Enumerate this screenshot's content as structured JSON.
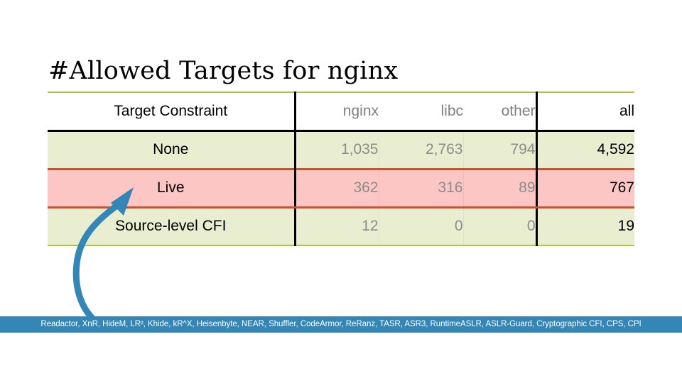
{
  "slide": {
    "title": "#Allowed Targets for nginx"
  },
  "table": {
    "columns": [
      {
        "key": "constraint",
        "label": "Target Constraint"
      },
      {
        "key": "nginx",
        "label": "nginx"
      },
      {
        "key": "libc",
        "label": "libc"
      },
      {
        "key": "other",
        "label": "other"
      },
      {
        "key": "all",
        "label": "all"
      }
    ],
    "rows": [
      {
        "constraint": "None",
        "nginx": "1,035",
        "libc": "2,763",
        "other": "794",
        "all": "4,592",
        "highlight": false
      },
      {
        "constraint": "Live",
        "nginx": "362",
        "libc": "316",
        "other": "89",
        "all": "767",
        "highlight": true
      },
      {
        "constraint": "Source-level CFI",
        "nginx": "12",
        "libc": "0",
        "other": "0",
        "all": "19",
        "highlight": false
      }
    ]
  },
  "annotation": {
    "arrow_target_row": "Live",
    "arrow_color": "#3386b5"
  },
  "caption": {
    "text": "Readactor, XnR, HideM, LR², Khide, kR^X, Heisenbyte, NEAR, Shuffler, CodeArmor, ReRanz, TASR, ASR3, RuntimeASLR, ASLR-Guard, Cryptographic CFI, CPS, CPI"
  },
  "colors": {
    "row_normal_bg": "#e9eed0",
    "row_highlight_bg": "#fbc6c4",
    "highlight_border": "#d0502b",
    "table_edge": "#b2c34a",
    "caption_bg": "#3386b5",
    "muted_text": "#8c8c8c"
  }
}
